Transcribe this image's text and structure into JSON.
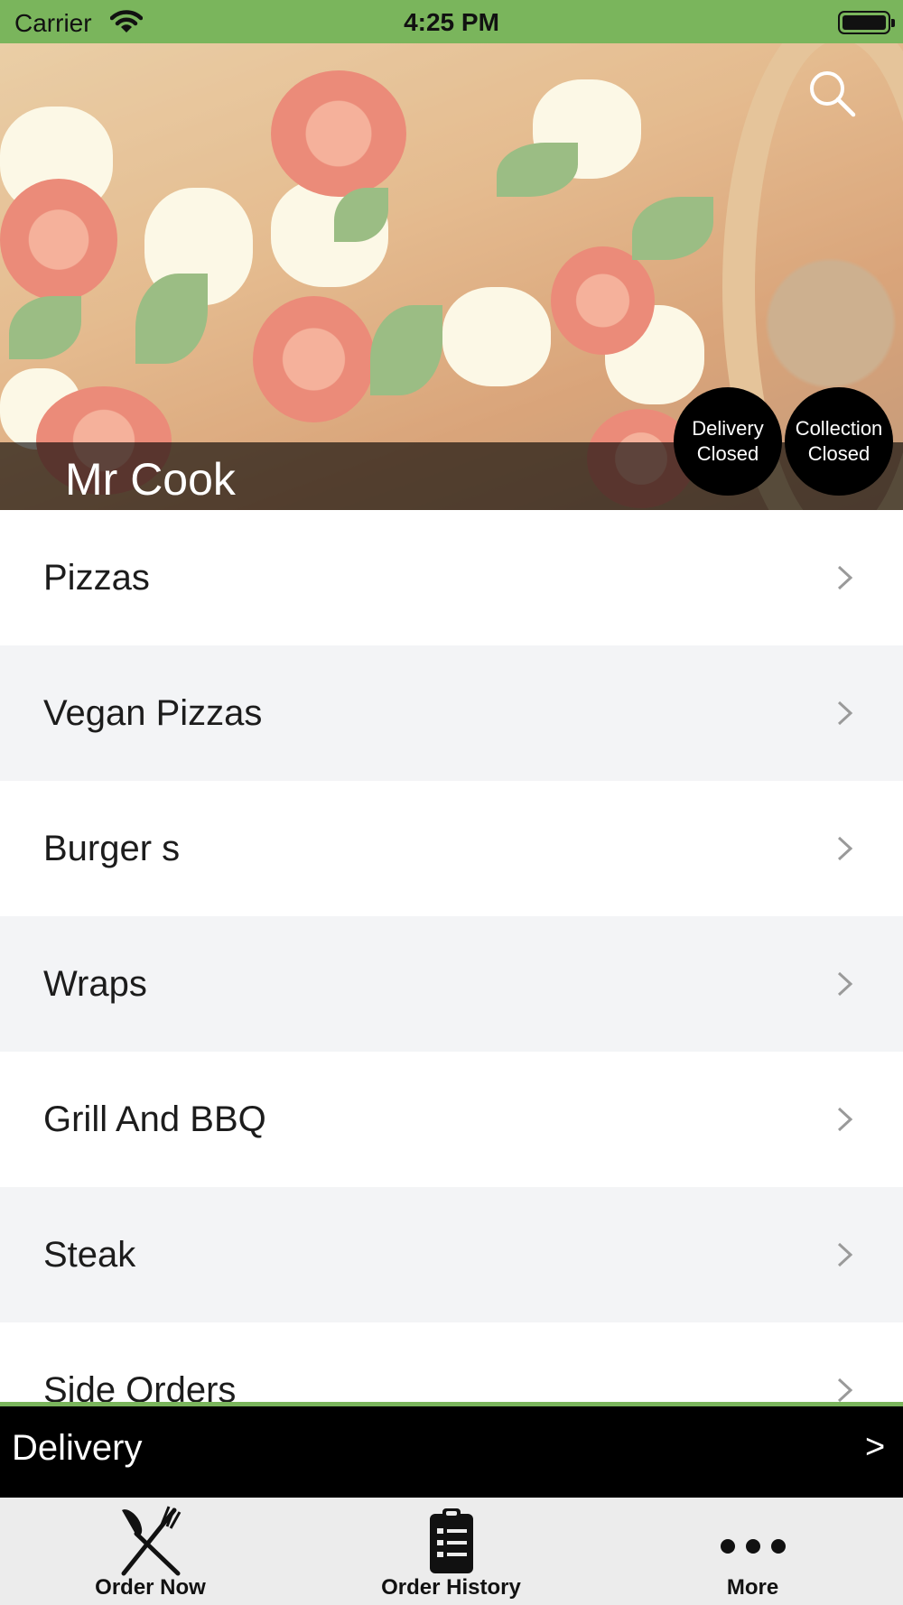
{
  "status_bar": {
    "carrier": "Carrier",
    "time": "4:25 PM"
  },
  "hero": {
    "restaurant_name": "Mr Cook",
    "delivery_status": {
      "line1": "Delivery",
      "line2": "Closed"
    },
    "collection_status": {
      "line1": "Collection",
      "line2": "Closed"
    }
  },
  "menu": {
    "categories": [
      {
        "label": "Pizzas"
      },
      {
        "label": "Vegan Pizzas"
      },
      {
        "label": "Burger s"
      },
      {
        "label": "Wraps"
      },
      {
        "label": "Grill And BBQ"
      },
      {
        "label": "Steak"
      },
      {
        "label": "Side Orders"
      }
    ]
  },
  "order_mode": {
    "label": "Delivery",
    "arrow": ">"
  },
  "tabs": [
    {
      "label": "Order Now",
      "icon": "fork-knife-icon"
    },
    {
      "label": "Order History",
      "icon": "clipboard-list-icon"
    },
    {
      "label": "More",
      "icon": "ellipsis-icon"
    }
  ],
  "colors": {
    "accent_green": "#7ab55c",
    "black": "#000000",
    "tab_bar": "#ececec",
    "row_alt": "#f3f4f6"
  }
}
